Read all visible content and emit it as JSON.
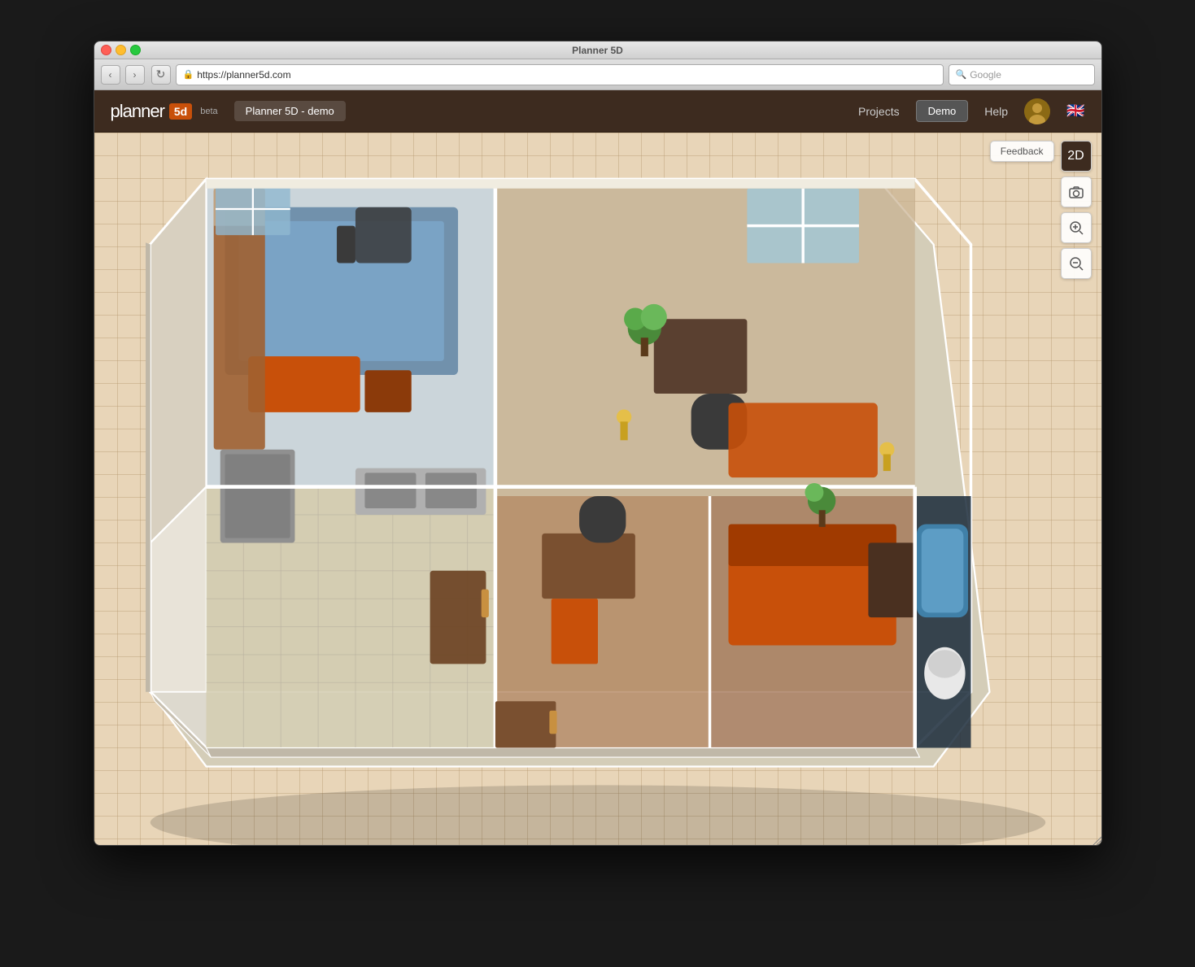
{
  "window": {
    "title": "Planner 5D",
    "url": "https://planner5d.com",
    "search_placeholder": "Google"
  },
  "header": {
    "logo_text": "planner",
    "logo_5d": "5d",
    "beta_label": "beta",
    "project_title": "Planner 5D - demo",
    "nav": {
      "projects": "Projects",
      "demo": "Demo",
      "help": "Help"
    }
  },
  "toolbar": {
    "feedback_label": "Feedback",
    "view_2d_label": "2D",
    "camera_icon": "📷",
    "zoom_in_icon": "🔍",
    "zoom_out_icon": "🔎"
  },
  "colors": {
    "header_bg": "#3d2b1f",
    "canvas_bg": "#e8d5b8",
    "grid_color": "#c9a882",
    "accent_orange": "#c8500a",
    "wall_color": "#f0ebe0",
    "floor_wood": "#a0724a",
    "floor_tile": "#d4cdb8"
  }
}
